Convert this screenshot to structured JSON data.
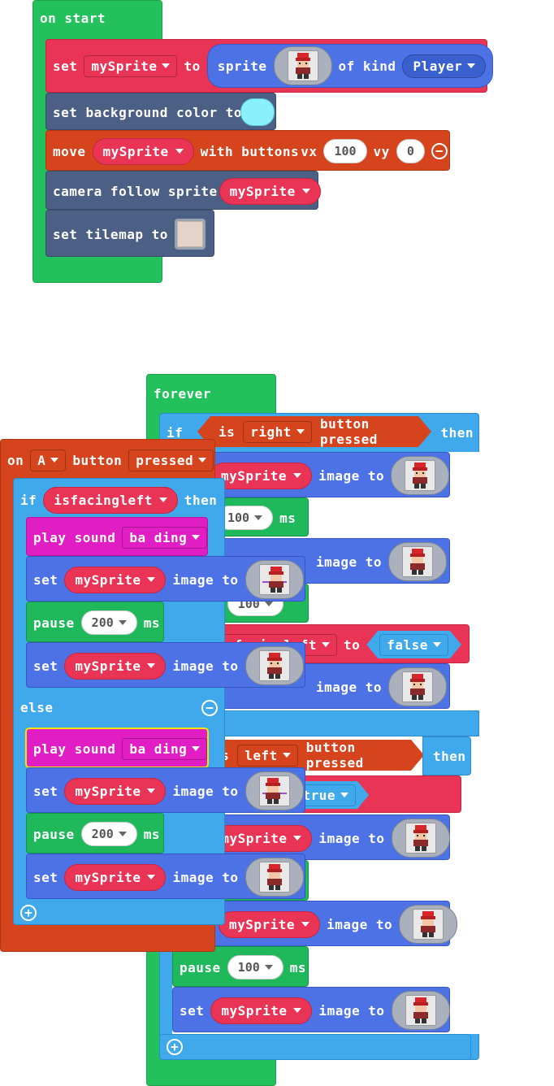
{
  "on_start": {
    "header": "on start",
    "set_label": "set",
    "var_name": "mySprite",
    "to_label": "to",
    "sprite_label": "sprite",
    "of_kind_label": "of kind",
    "kind_value": "Player",
    "bg_color_label": "set background color to",
    "bg_color": "#8af0fb",
    "move_label": "move",
    "with_buttons_label": "with buttons",
    "vx_label": "vx",
    "vx_value": "100",
    "vy_label": "vy",
    "vy_value": "0",
    "camera_label": "camera follow sprite",
    "tilemap_label": "set tilemap to"
  },
  "forever": {
    "header": "forever",
    "if_label": "if",
    "is_label": "is",
    "right_value": "right",
    "button_pressed_label": "button pressed",
    "then_label": "then",
    "left_value": "left",
    "set_label": "set",
    "var_name": "mySprite",
    "image_to_label": "image to",
    "pause_label": "pause",
    "pause_value": "100",
    "ms_label": "ms",
    "facing_var": "isfacingleft",
    "to_label": "to",
    "false_value": "false",
    "true_value": "true",
    "partial_var": "isfacingleft",
    "partial_left": "ft"
  },
  "on_a": {
    "on_label": "on",
    "button_value": "A",
    "button_label": "button",
    "event_value": "pressed",
    "if_label": "if",
    "cond_var": "isfacingleft",
    "then_label": "then",
    "play_sound_label": "play sound",
    "sound_value": "ba ding",
    "set_label": "set",
    "var_name": "mySprite",
    "image_to_label": "image to",
    "pause_label": "pause",
    "pause_value": "200",
    "ms_label": "ms",
    "else_label": "else"
  },
  "icons": [
    "sprite-character-icon",
    "tile-icon",
    "minus-circle-icon",
    "plus-circle-icon",
    "dropdown-arrow-icon"
  ],
  "colors": {
    "events": "#23c15b",
    "logic": "#3fa9ec",
    "sprites": "#4d72e6",
    "scene": "#4c6085",
    "controller": "#d5441c",
    "variables": "#ea3456",
    "music": "#e11ec3"
  }
}
